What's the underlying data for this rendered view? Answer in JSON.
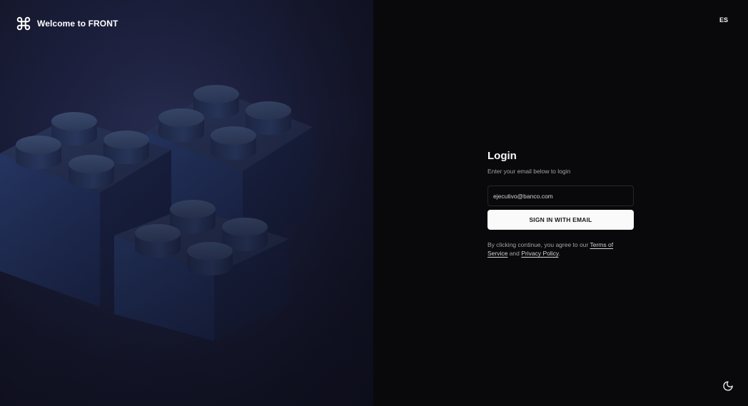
{
  "brand": {
    "title_prefix": "Welcome to ",
    "title_strong": "FRONT",
    "logo_icon": "command-icon"
  },
  "header": {
    "language_label": "ES"
  },
  "login": {
    "heading": "Login",
    "subtitle": "Enter your email below to login",
    "email_value": "ejecutivo@banco.com",
    "submit_label": "SIGN IN WITH EMAIL",
    "terms_prefix": "By clicking continue, you agree to our ",
    "terms_link": "Terms of Service",
    "terms_middle": " and ",
    "privacy_link": "Privacy Policy",
    "terms_suffix": "."
  },
  "footer": {
    "theme_toggle_icon": "moon-icon"
  },
  "colors": {
    "left_bg": "#1d2140",
    "right_bg": "#09090b",
    "button_bg": "#fafafa",
    "brick": "#2a3a64"
  }
}
